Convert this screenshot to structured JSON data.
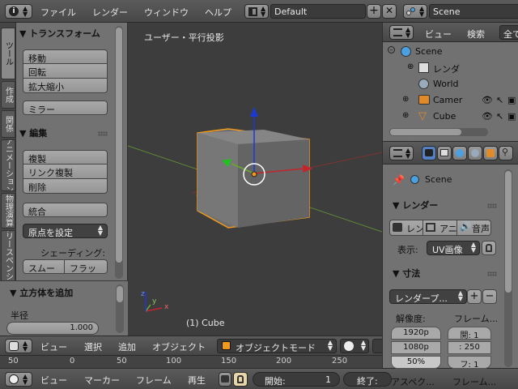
{
  "menu": {
    "items": [
      "ファイル",
      "レンダー",
      "ウィンドウ",
      "ヘルプ"
    ],
    "layout_name": "Default",
    "scene_name": "Scene"
  },
  "tool_tabs": [
    "ツール",
    "作成",
    "関係",
    "アニメーション",
    "物理演算",
    "グリースペンシル"
  ],
  "tool_shelf": {
    "transform_header": "▼ トランスフォーム",
    "transform_buttons": [
      "移動",
      "回転",
      "拡大縮小"
    ],
    "mirror_button": "ミラー",
    "edit_header": "▼ 編集",
    "edit_buttons": [
      "複製",
      "リンク複製",
      "削除"
    ],
    "join_button": "統合",
    "origin_dropdown": "原点を設定",
    "shading_label": "シェーディング:",
    "shading_buttons": [
      "スムー",
      "フラッ"
    ]
  },
  "redo_panel": {
    "header": "▼ 立方体を追加",
    "radius_label": "半径",
    "radius_value": "1.000"
  },
  "viewport": {
    "view_label": "ユーザー・平行投影",
    "object_label": "(1) Cube",
    "axes": {
      "x": "x",
      "y": "y",
      "z": "z"
    }
  },
  "view_header": {
    "menus": [
      "ビュー",
      "選択",
      "追加",
      "オブジェクト"
    ],
    "mode": "オブジェクトモード"
  },
  "timeline": {
    "ticks": [
      "50",
      "0",
      "50",
      "100",
      "150",
      "200",
      "250"
    ],
    "menus": [
      "ビュー",
      "マーカー",
      "フレーム",
      "再生"
    ],
    "start_label": "開始:",
    "start_value": "1",
    "end_label": "終了:"
  },
  "outliner": {
    "menus": [
      "ビュー",
      "検索",
      "全て"
    ],
    "rows": [
      {
        "name": "Scene"
      },
      {
        "name": "レンダ"
      },
      {
        "name": "World"
      },
      {
        "name": "Camer"
      },
      {
        "name": "Cube"
      }
    ]
  },
  "properties": {
    "context": "Scene",
    "render_header": "▼ レンダー",
    "render_buttons": [
      "レン",
      "アニ",
      "音声"
    ],
    "display_label": "表示:",
    "display_value": "UV画像",
    "dimensions_header": "▼ 寸法",
    "preset_value": "レンダープ...",
    "resolution_label": "解像度:",
    "frame_range_label": "フレーム...",
    "res_x": "1920p",
    "res_y": "1080p",
    "res_percent": "50%",
    "frame_start": "開: 1",
    "frame_end": ": 250",
    "frame_step": "フ: 1",
    "aspect_label": "アスペク...",
    "frame_rate_label": "フレーム..."
  },
  "colors": {
    "selection_outline": "#f29a1d",
    "x_axis": "#c2262b",
    "y_axis": "#6aa82d",
    "z_axis": "#1a3ad2"
  }
}
